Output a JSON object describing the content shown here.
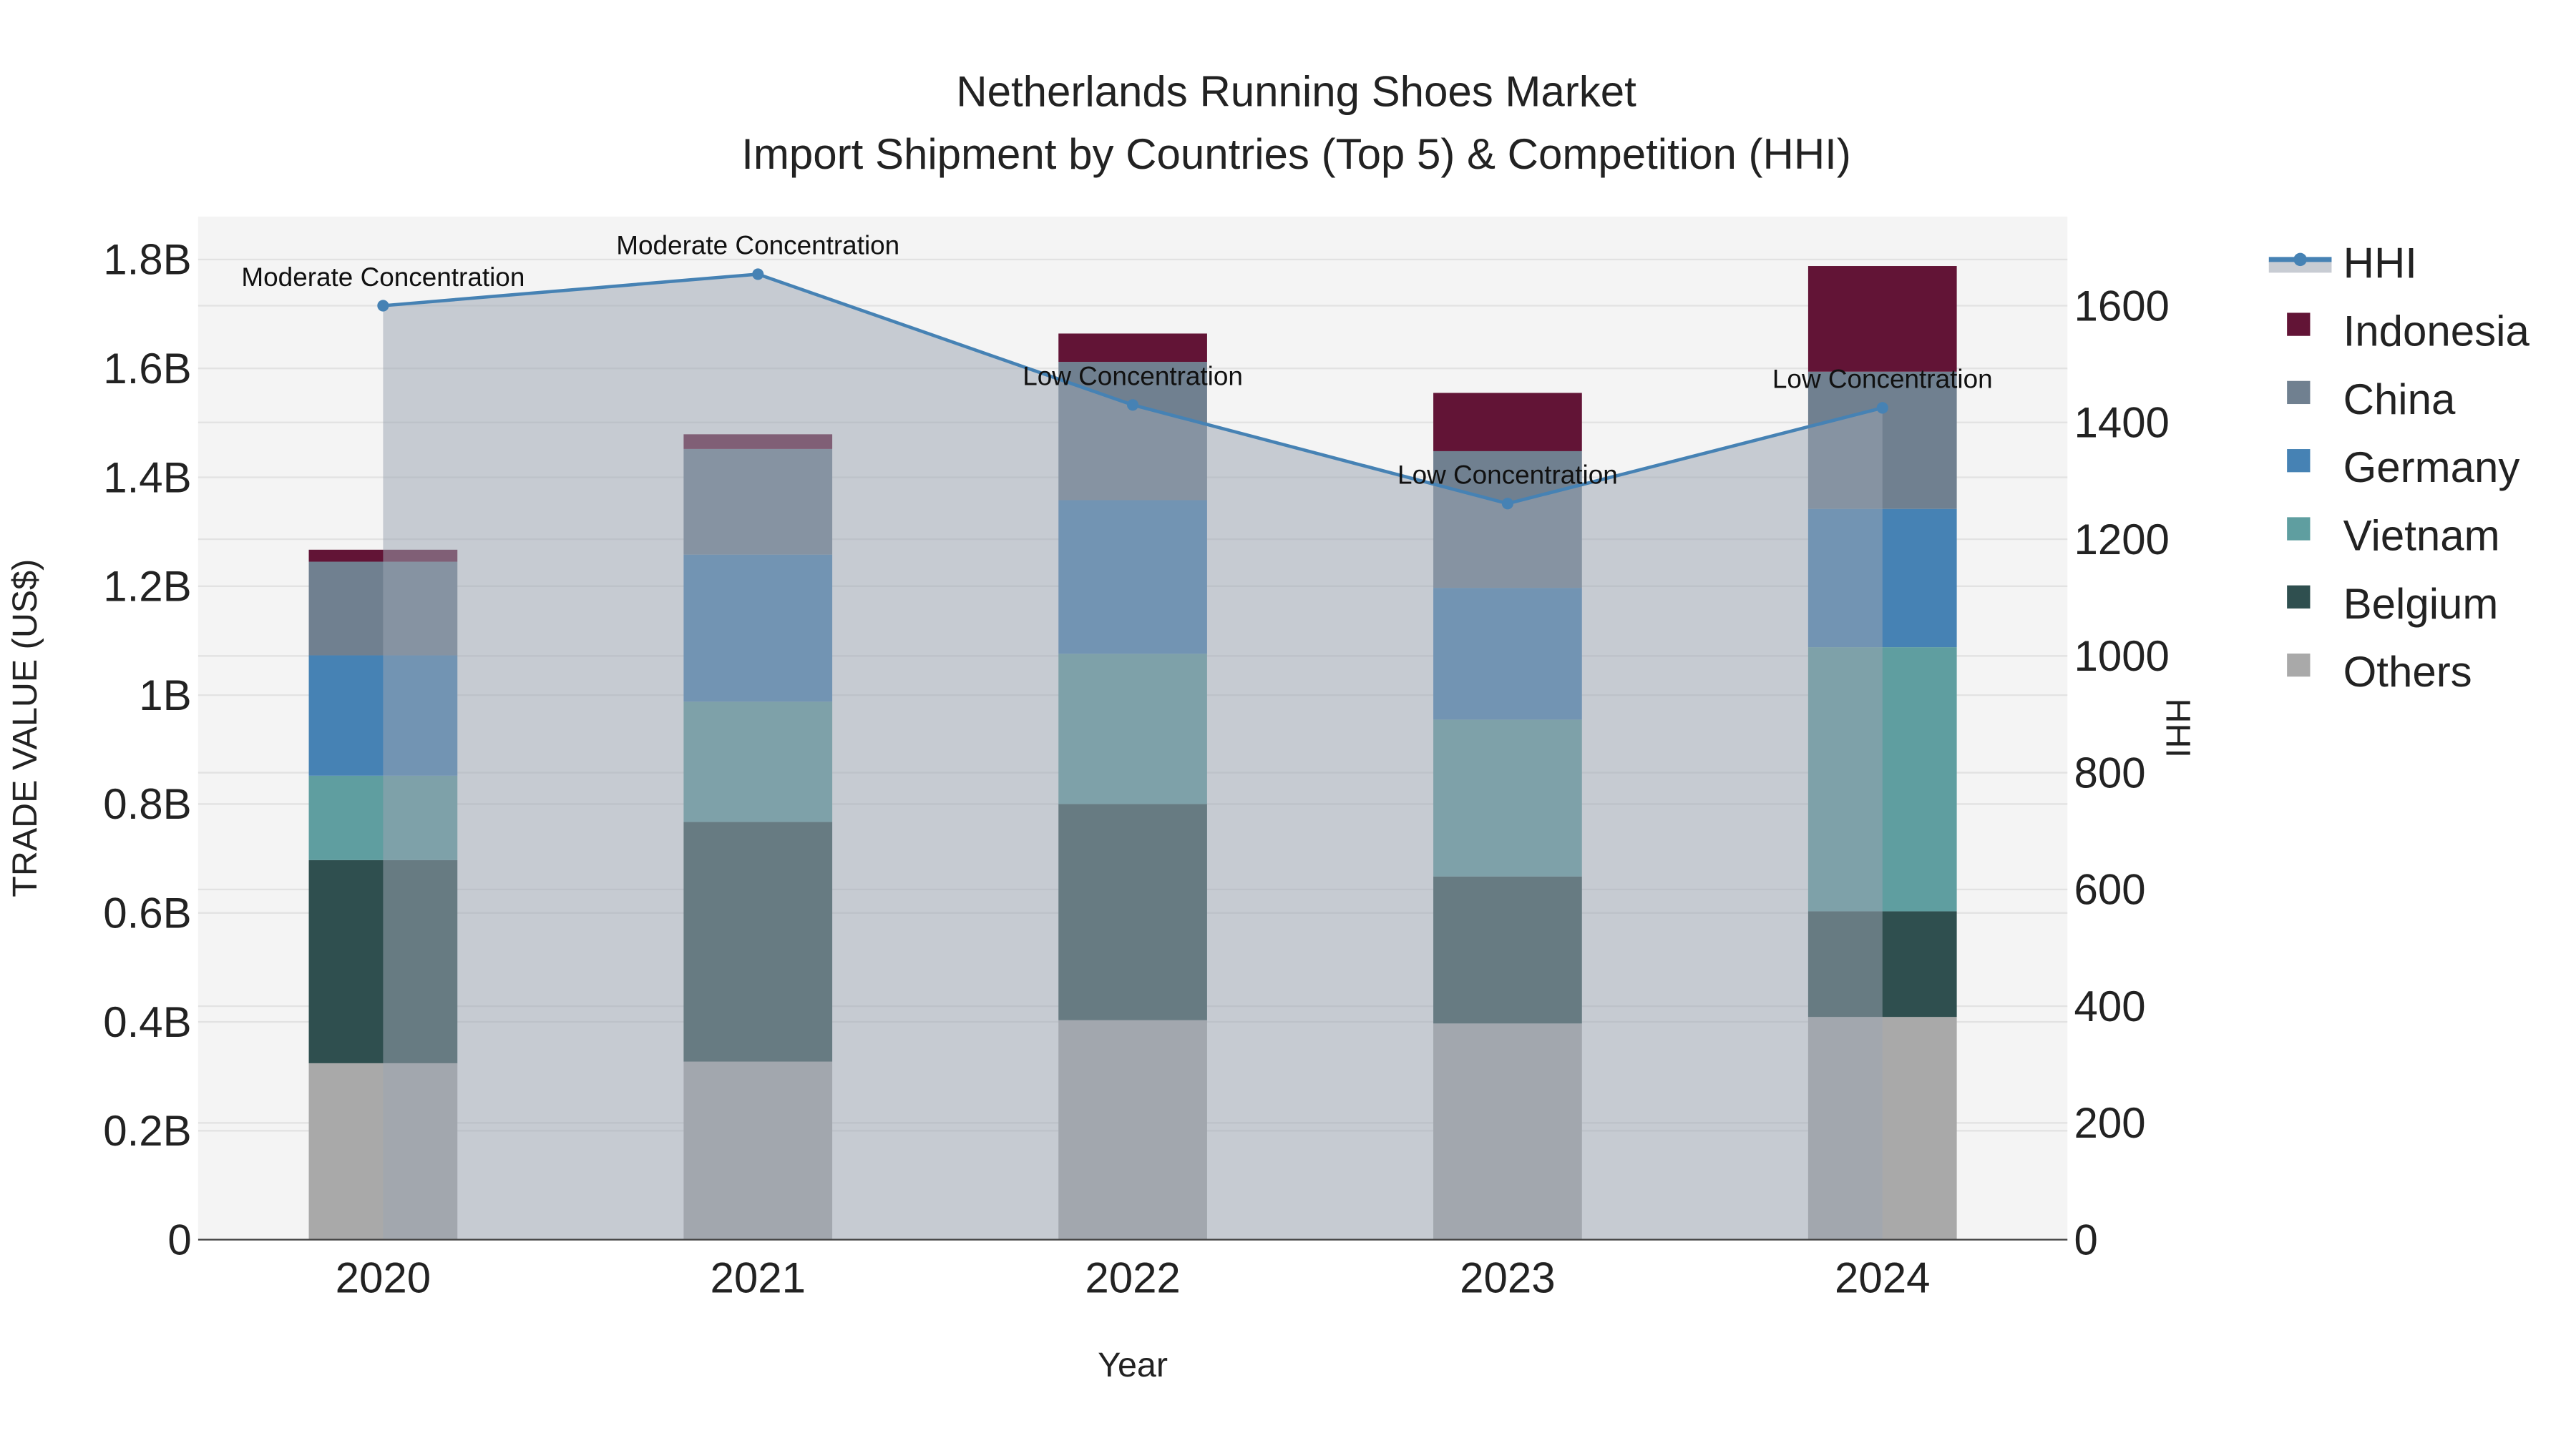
{
  "chart_data": {
    "type": "bar",
    "stacked": true,
    "title": "Netherlands Running Shoes Market",
    "subtitle": "Import Shipment by Countries (Top 5) & Competition (HHI)",
    "xlabel": "Year",
    "ylabel": "TRADE VALUE (US$)",
    "y2label": "HHI",
    "categories": [
      "2020",
      "2021",
      "2022",
      "2023",
      "2024"
    ],
    "ylim": [
      0,
      1880000000
    ],
    "y_ticks": [
      0,
      200000000,
      400000000,
      600000000,
      800000000,
      1000000000,
      1200000000,
      1400000000,
      1600000000,
      1800000000
    ],
    "y_tick_labels": [
      "0",
      "0.2B",
      "0.4B",
      "0.6B",
      "0.8B",
      "1B",
      "1.2B",
      "1.4B",
      "1.6B",
      "1.8B"
    ],
    "y2lim": [
      0,
      1750
    ],
    "y2_ticks": [
      0,
      200,
      400,
      600,
      800,
      1000,
      1200,
      1400,
      1600
    ],
    "y2_tick_labels": [
      "0",
      "200",
      "400",
      "600",
      "800",
      "1000",
      "1200",
      "1400",
      "1600"
    ],
    "grid": true,
    "legend_position": "right",
    "series": [
      {
        "name": "Others",
        "color": "#A9A9A9",
        "values": [
          324000000,
          327000000,
          403000000,
          397000000,
          409000000
        ]
      },
      {
        "name": "Belgium",
        "color": "#2F4F4F",
        "values": [
          373000000,
          440000000,
          397000000,
          270000000,
          194000000
        ]
      },
      {
        "name": "Vietnam",
        "color": "#5F9EA0",
        "values": [
          155000000,
          221000000,
          276000000,
          288000000,
          485000000
        ]
      },
      {
        "name": "Germany",
        "color": "#4682B4",
        "values": [
          221000000,
          270000000,
          282000000,
          242000000,
          254000000
        ]
      },
      {
        "name": "China",
        "color": "#708090",
        "values": [
          172000000,
          194000000,
          254000000,
          251000000,
          252000000
        ]
      },
      {
        "name": "Indonesia",
        "color": "#621436",
        "values": [
          22000000,
          27000000,
          52000000,
          107000000,
          194000000
        ]
      }
    ],
    "hhi": {
      "name": "HHI",
      "color": "#4682B4",
      "values": [
        1600,
        1654,
        1430,
        1261,
        1425
      ],
      "annotations": [
        "Moderate Concentration",
        "Moderate Concentration",
        "Low Concentration",
        "Low Concentration",
        "Low Concentration"
      ]
    },
    "legend": [
      "HHI",
      "Indonesia",
      "China",
      "Germany",
      "Vietnam",
      "Belgium",
      "Others"
    ]
  }
}
